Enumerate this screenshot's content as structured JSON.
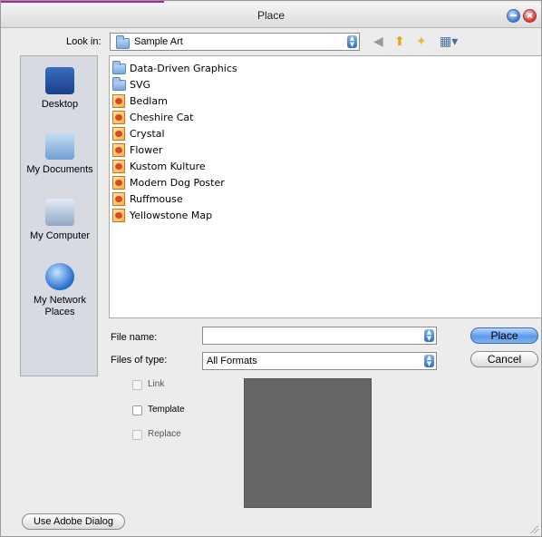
{
  "window": {
    "title": "Place",
    "colors": {
      "accent_line": "#a22b9c",
      "minimize": "#4d86d6",
      "close": "#e0443b",
      "preview_bg": "#666666",
      "primary_button": "#5c9ae8"
    }
  },
  "toolbar": {
    "look_in_label": "Look in:",
    "look_in_value": "Sample Art",
    "icons": [
      "back-icon",
      "up-folder-icon",
      "new-folder-icon",
      "view-menu-icon"
    ]
  },
  "sidebar": {
    "places": [
      {
        "label": "Desktop",
        "icon": "desktop-icon"
      },
      {
        "label": "My Documents",
        "icon": "documents-icon"
      },
      {
        "label": "My Computer",
        "icon": "computer-icon"
      },
      {
        "label": "My Network Places",
        "icon": "network-icon"
      }
    ]
  },
  "files": [
    {
      "name": "Data-Driven Graphics",
      "type": "folder"
    },
    {
      "name": "SVG",
      "type": "folder"
    },
    {
      "name": "Bedlam",
      "type": "ai"
    },
    {
      "name": "Cheshire Cat",
      "type": "ai"
    },
    {
      "name": "Crystal",
      "type": "ai"
    },
    {
      "name": "Flower",
      "type": "ai"
    },
    {
      "name": "Kustom Kulture",
      "type": "ai"
    },
    {
      "name": "Modern Dog Poster",
      "type": "ai"
    },
    {
      "name": "Ruffmouse",
      "type": "ai"
    },
    {
      "name": "Yellowstone Map",
      "type": "ai"
    }
  ],
  "form": {
    "file_name_label": "File name:",
    "file_name_value": "",
    "files_of_type_label": "Files of type:",
    "files_of_type_value": "All Formats"
  },
  "buttons": {
    "place": "Place",
    "cancel": "Cancel",
    "use_adobe_dialog": "Use Adobe Dialog"
  },
  "options": {
    "link": "Link",
    "template": "Template",
    "replace": "Replace"
  }
}
